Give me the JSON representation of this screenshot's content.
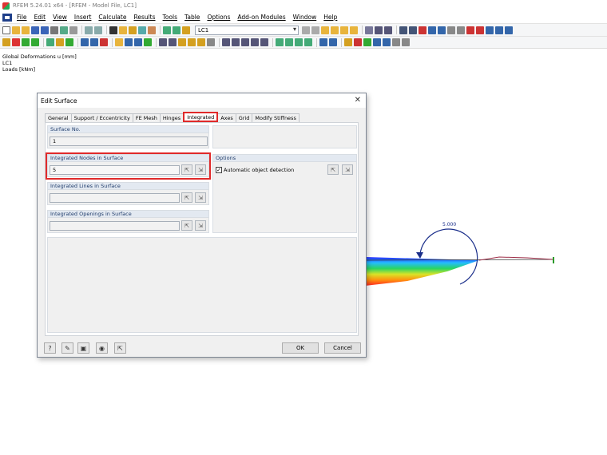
{
  "window": {
    "title": "RFEM 5.24.01 x64 - [RFEM - Model File, LC1]"
  },
  "menu": [
    "File",
    "Edit",
    "View",
    "Insert",
    "Calculate",
    "Results",
    "Tools",
    "Table",
    "Options",
    "Add-on Modules",
    "Window",
    "Help"
  ],
  "toolbar": {
    "load_case": "LC1"
  },
  "info": {
    "line1": "Global Deformations u [mm]",
    "line2": "LC1",
    "line3": "Loads [kNm]"
  },
  "model": {
    "moment_label": "5.000"
  },
  "dialog": {
    "title": "Edit Surface",
    "close_glyph": "✕",
    "tabs": [
      "General",
      "Support / Eccentricity",
      "FE Mesh",
      "Hinges",
      "Integrated",
      "Axes",
      "Grid",
      "Modify Stiffness"
    ],
    "active_tab": "Integrated",
    "surface_no": {
      "label": "Surface No.",
      "value": "1"
    },
    "nodes": {
      "label": "Integrated Nodes in Surface",
      "value": "5"
    },
    "lines": {
      "label": "Integrated Lines in Surface",
      "value": ""
    },
    "openings": {
      "label": "Integrated Openings in Surface",
      "value": ""
    },
    "options": {
      "label": "Options",
      "auto_detect": "Automatic object detection",
      "auto_checked": true
    },
    "ok": "OK",
    "cancel": "Cancel"
  },
  "colors": {
    "highlight": "#e02a2a",
    "tab_header": "#e3e9f1"
  }
}
